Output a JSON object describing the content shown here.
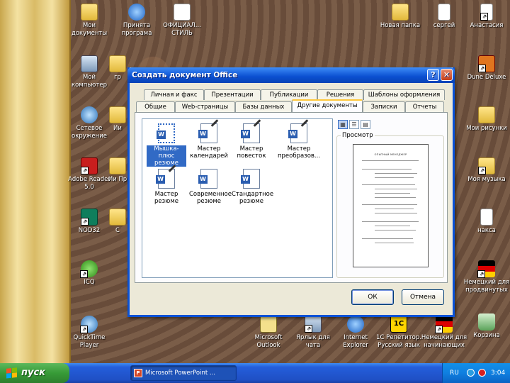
{
  "desktop": {
    "icons": [
      {
        "label": "Мои документы",
        "icon": "folder-icon"
      },
      {
        "label": "Принята програма",
        "icon": "ie-icon"
      },
      {
        "label": "ОФИЦИАЛ... СТИЛЬ",
        "icon": "ppt-icon"
      },
      {
        "label": "Мой компьютер",
        "icon": "computer-icon"
      },
      {
        "label": "гр",
        "icon": "folder-icon"
      },
      {
        "label": "Сетевое окружение",
        "icon": "network-icon"
      },
      {
        "label": "Ии",
        "icon": "folder-icon"
      },
      {
        "label": "Adobe Reader 5.0",
        "icon": "pdf-icon"
      },
      {
        "label": "Ии Пр",
        "icon": "folder-icon"
      },
      {
        "label": "NOD32",
        "icon": "nod32-icon"
      },
      {
        "label": "С",
        "icon": "folder-icon"
      },
      {
        "label": "ICQ",
        "icon": "icq-icon"
      },
      {
        "label": "QuickTime Player",
        "icon": "quicktime-icon"
      },
      {
        "label": "Новая папка",
        "icon": "folder-icon"
      },
      {
        "label": "сергей",
        "icon": "document-icon"
      },
      {
        "label": "Анастасия",
        "icon": "document-icon"
      },
      {
        "label": "Dune Deluxe",
        "icon": "game-icon"
      },
      {
        "label": "Мои рисунки",
        "icon": "pictures-icon"
      },
      {
        "label": "Моя музыка",
        "icon": "music-icon"
      },
      {
        "label": "накса",
        "icon": "document-icon"
      },
      {
        "label": "Немецкий для продвинутых",
        "icon": "german-flag-icon"
      },
      {
        "label": "Корзина",
        "icon": "recycle-bin-icon"
      },
      {
        "label": "Microsoft Outlook",
        "icon": "outlook-icon"
      },
      {
        "label": "Ярлык для чата",
        "icon": "chat-icon"
      },
      {
        "label": "Internet Explorer",
        "icon": "ie-icon"
      },
      {
        "label": "1С Репетитор. Русский язык",
        "icon": "1c-icon"
      },
      {
        "label": "Немецкий для начинающих",
        "icon": "german-flag-icon"
      }
    ]
  },
  "dialog": {
    "title": "Создать документ Office",
    "help_label": "?",
    "close_label": "✕",
    "tabs_back": [
      "Личная и факс",
      "Презентации",
      "Публикации",
      "Решения",
      "Шаблоны оформления"
    ],
    "tabs_front": [
      "Общие",
      "Web-страницы",
      "Базы данных",
      "Другие документы",
      "Записки",
      "Отчеты"
    ],
    "active_tab": "Другие документы",
    "items": [
      {
        "label": "Мышка-плюс резюме",
        "selected": true,
        "wand": false
      },
      {
        "label": "Мастер календарей",
        "selected": false,
        "wand": true
      },
      {
        "label": "Мастер повесток",
        "selected": false,
        "wand": true
      },
      {
        "label": "Мастер преобразов...",
        "selected": false,
        "wand": true
      },
      {
        "label": "Мастер резюме",
        "selected": false,
        "wand": true
      },
      {
        "label": "Современное резюме",
        "selected": false,
        "wand": false
      },
      {
        "label": "Стандартное резюме",
        "selected": false,
        "wand": false
      }
    ],
    "preview_label": "Просмотр",
    "preview_page_title": "ОПЫТНЫЙ МЕНЕДЖЕР",
    "ok_label": "ОК",
    "cancel_label": "Отмена"
  },
  "taskbar": {
    "start_label": "пуск",
    "task_label": "Microsoft PowerPoint ...",
    "task_icon_letter": "P",
    "lang": "RU",
    "clock": "3:04"
  }
}
